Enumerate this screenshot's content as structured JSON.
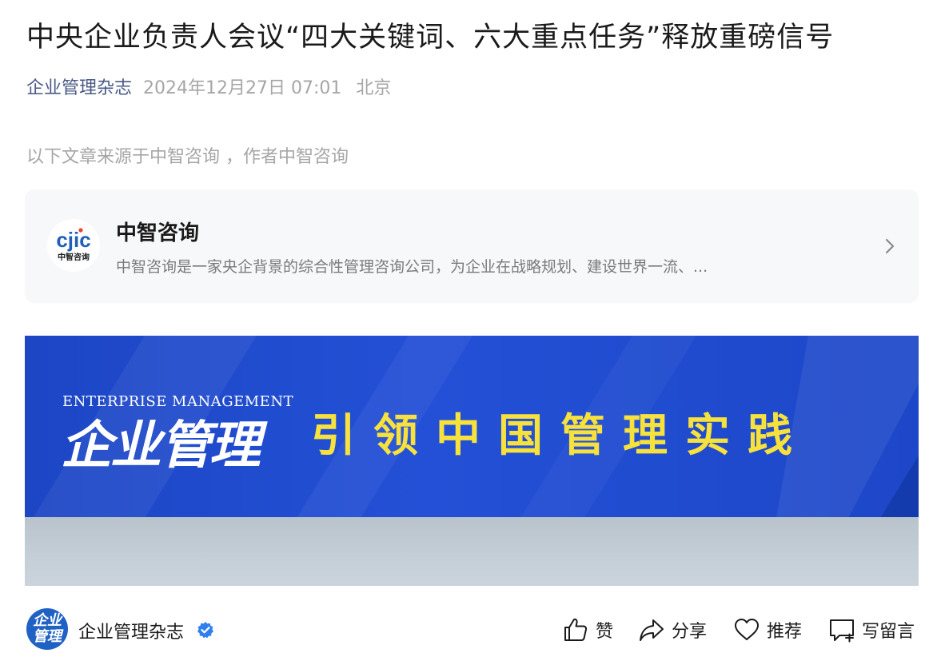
{
  "article": {
    "title": "中央企业负责人会议“四大关键词、六大重点任务”释放重磅信号",
    "publisher": "企业管理杂志",
    "date": "2024年12月27日 07:01",
    "location": "北京",
    "source_line": "以下文章来源于中智咨询 ，作者中智咨询"
  },
  "source_card": {
    "logo_text": "cjic",
    "logo_subtext": "中智咨询",
    "name": "中智咨询",
    "description": "中智咨询是一家央企背景的综合性管理咨询公司，为企业在战略规划、建设世界一流、..."
  },
  "banner": {
    "english_label": "ENTERPRISE MANAGEMENT",
    "brand": "企业管理",
    "slogan": "引领中国管理实践"
  },
  "footer": {
    "avatar_text": "企业管理",
    "account_name": "企业管理杂志",
    "actions": [
      {
        "label": "赞",
        "icon": "thumbs-up-icon"
      },
      {
        "label": "分享",
        "icon": "share-icon"
      },
      {
        "label": "推荐",
        "icon": "heart-icon"
      },
      {
        "label": "写留言",
        "icon": "comment-icon"
      }
    ]
  },
  "colors": {
    "publisher_link": "#4a5a86",
    "banner_blue": "#2350d6",
    "slogan_yellow": "#f7e13c",
    "verified_blue": "#2f80ed"
  }
}
